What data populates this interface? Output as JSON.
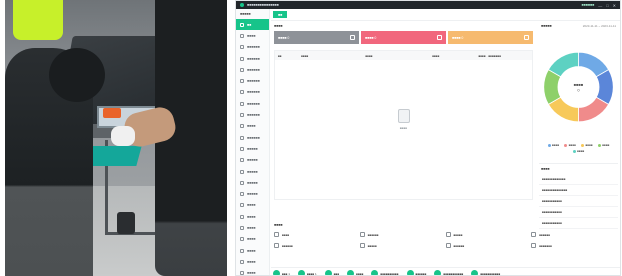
{
  "window": {
    "title": "■■■■■■■■■■■■■■■",
    "user": "■■■■■■",
    "minimize": "—",
    "maximize": "□",
    "close": "✕"
  },
  "sidebar": {
    "title": "■■■■■",
    "items": [
      {
        "label": "■■",
        "active": true,
        "icon": "home-icon"
      },
      {
        "label": "■■■■",
        "icon": "folder-icon"
      },
      {
        "label": "■■■■■■",
        "icon": "folder-icon"
      },
      {
        "label": "■■■■■■",
        "icon": "folder-icon"
      },
      {
        "label": "■■■■■■",
        "icon": "folder-icon"
      },
      {
        "label": "■■■■■■",
        "icon": "folder-icon"
      },
      {
        "label": "■■■■■■",
        "icon": "folder-icon"
      },
      {
        "label": "■■■■■■",
        "icon": "folder-icon"
      },
      {
        "label": "■■■■■■",
        "icon": "folder-icon"
      },
      {
        "label": "■■■■",
        "icon": "folder-icon"
      },
      {
        "label": "■■■■■■",
        "icon": "folder-icon"
      },
      {
        "label": "■■■■■",
        "icon": "folder-icon"
      },
      {
        "label": "■■■■■",
        "icon": "folder-icon"
      },
      {
        "label": "■■■■■",
        "icon": "folder-icon"
      },
      {
        "label": "■■■■■",
        "icon": "folder-icon"
      },
      {
        "label": "■■■■■",
        "icon": "folder-icon"
      },
      {
        "label": "■■■■",
        "icon": "folder-icon"
      },
      {
        "label": "■■■■",
        "icon": "folder-icon"
      },
      {
        "label": "■■■■",
        "icon": "folder-icon"
      },
      {
        "label": "■■■■",
        "icon": "folder-icon"
      },
      {
        "label": "■■■■",
        "icon": "folder-icon"
      },
      {
        "label": "■■■■",
        "icon": "folder-icon"
      },
      {
        "label": "■■■■",
        "icon": "folder-icon"
      }
    ]
  },
  "tab": {
    "label": "■■"
  },
  "main": {
    "section_title": "■■■■",
    "cards": [
      {
        "label": "■■■■ 0",
        "color": "#8e9298"
      },
      {
        "label": "■■■■ 0",
        "color": "#f1677d"
      },
      {
        "label": "■■■■ 0",
        "color": "#f6ba6f"
      }
    ],
    "table_headers": [
      "■■",
      "■■■■",
      "■■■■",
      "■■■■",
      "■■■■ · ■■■■■■■"
    ],
    "empty_text": "■■■■"
  },
  "quick": {
    "title": "■■■■",
    "items": [
      "■■■■",
      "■■■■■■",
      "■■■■■",
      "■■■■■■",
      "■■■■■■",
      "■■■■■",
      "■■■■■■",
      "■■■■■■■"
    ]
  },
  "status_bar": [
    {
      "label": "■■■ 1"
    },
    {
      "label": "■■■■ 1"
    },
    {
      "label": "■■■"
    },
    {
      "label": "■■■■"
    },
    {
      "label": "■■■■■■■■■■"
    },
    {
      "label": "■■■■■■"
    },
    {
      "label": "■■■■■■■■■■■"
    },
    {
      "label": "■■■■■■■■■■■"
    }
  ],
  "right_panel": {
    "title": "■■■■■",
    "date_range": "2023-11-11 ~ 2023-11-11",
    "pie_center": "■■■■\n0",
    "legend": [
      {
        "label": "■■■■",
        "color": "#6fa9e6"
      },
      {
        "label": "■■■■",
        "color": "#f08b8b"
      },
      {
        "label": "■■■■",
        "color": "#f7c95a"
      },
      {
        "label": "■■■■",
        "color": "#8ed06a"
      },
      {
        "label": "■■■■",
        "color": "#5dd1c2"
      }
    ],
    "list_title": "■■■■",
    "list_items": [
      "■■■■■■■■■■■■■",
      "■■■■■■■■■■■■■■",
      "■■■■■■■■■■■",
      "■■■■■■■■■■■",
      "■■■■■■■■■■■"
    ]
  },
  "chart_data": {
    "type": "pie",
    "title": "",
    "categories": [
      "■■■■",
      "■■■■",
      "■■■■",
      "■■■■",
      "■■■■",
      "■■■■"
    ],
    "values": [
      1,
      1,
      1,
      1,
      1,
      1
    ],
    "colors": [
      "#6fa9e6",
      "#5b86d9",
      "#f08b8b",
      "#f7c95a",
      "#8ed06a",
      "#5dd1c2"
    ],
    "center_label": "■■■■ 0"
  }
}
